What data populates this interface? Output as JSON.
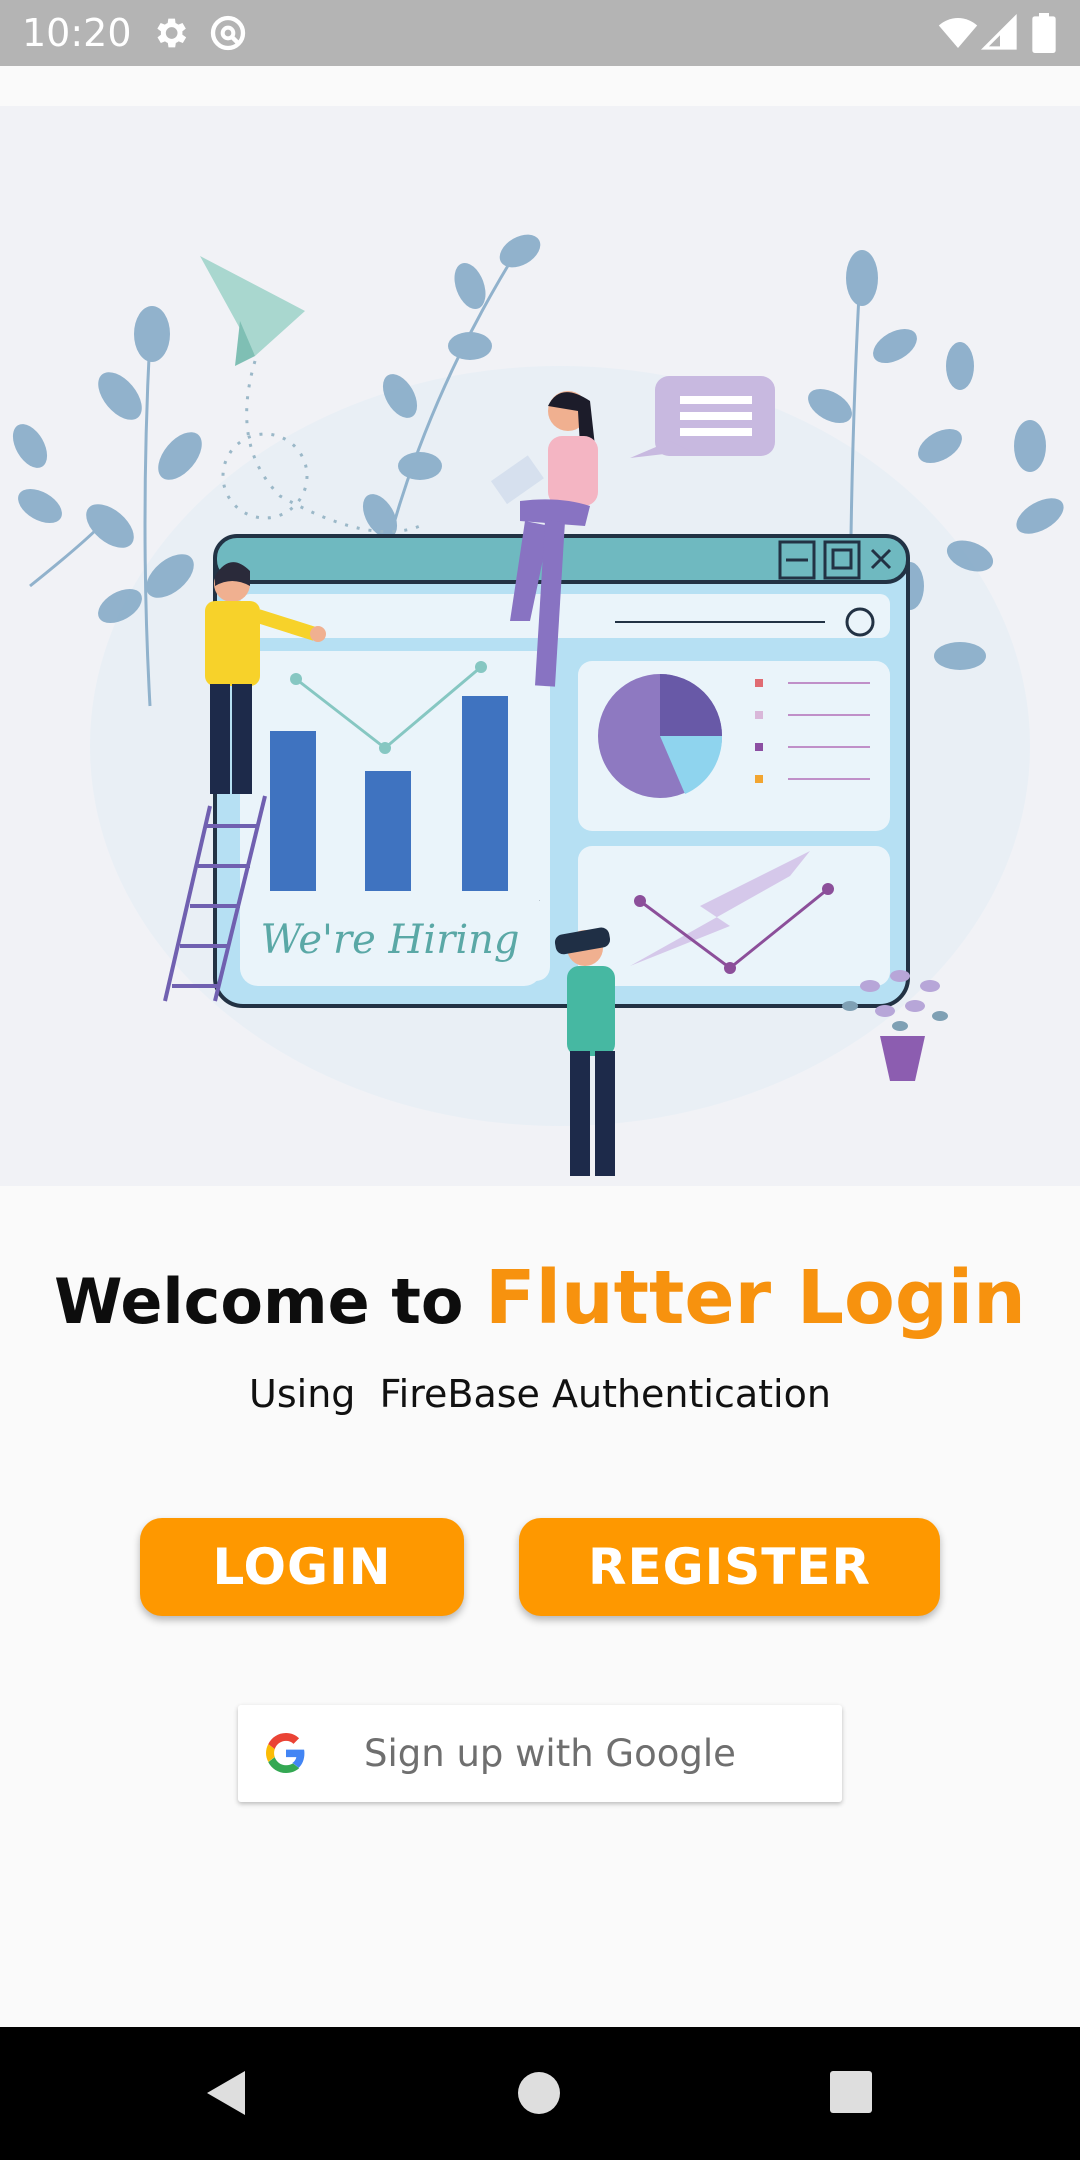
{
  "status_bar": {
    "time": "10:20",
    "icons": [
      "gear-icon",
      "sync-icon",
      "wifi-icon",
      "cell-signal-icon",
      "battery-icon"
    ]
  },
  "hero": {
    "illustration": "hiring-dashboard-illustration",
    "banner_text": "We're Hiring"
  },
  "welcome": {
    "prefix": "Welcome to ",
    "app_name": "Flutter Login"
  },
  "subtitle": "Using  FireBase Authentication",
  "buttons": {
    "login": "LOGIN",
    "register": "REGISTER"
  },
  "google": {
    "label": "Sign up with Google",
    "icon": "google-logo-icon"
  },
  "nav": {
    "icons": [
      "back-icon",
      "home-icon",
      "recents-icon"
    ]
  },
  "colors": {
    "accent": "#fe9800",
    "title_accent": "#f7920e",
    "status_bar": "#b4b4b4",
    "nav_bar": "#000000"
  }
}
